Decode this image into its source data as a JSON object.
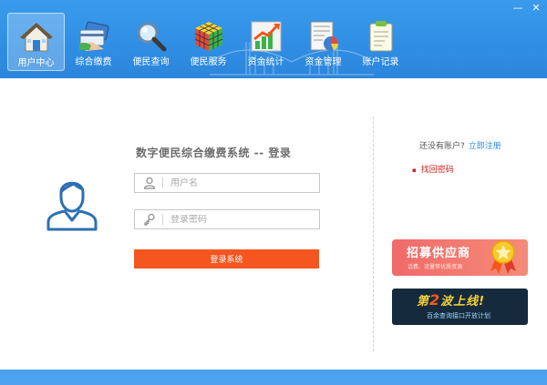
{
  "window": {
    "minimize": "—",
    "close": "✕"
  },
  "toolbar": {
    "items": [
      {
        "label": "用户中心",
        "icon": "home-icon",
        "active": true
      },
      {
        "label": "综合缴费",
        "icon": "payment-card-icon",
        "active": false
      },
      {
        "label": "便民查询",
        "icon": "magnifier-icon",
        "active": false
      },
      {
        "label": "便民服务",
        "icon": "cube-icon",
        "active": false
      },
      {
        "label": "资金统计",
        "icon": "bar-chart-icon",
        "active": false
      },
      {
        "label": "资金管理",
        "icon": "ledger-pie-icon",
        "active": false
      },
      {
        "label": "账户记录",
        "icon": "clipboard-icon",
        "active": false
      }
    ]
  },
  "login": {
    "title": "数字便民综合缴费系统 -- 登录",
    "username_placeholder": "用户名",
    "password_placeholder": "登录密码",
    "submit_label": "登录系统"
  },
  "side": {
    "no_account_text": "还没有账户?",
    "register_link": "立即注册",
    "find_password": "找回密码"
  },
  "banners": {
    "supplier_title": "招募供应商",
    "supplier_sub": "话费、流量等优质资源",
    "wave_prefix": "第",
    "wave_number": "2",
    "wave_suffix": "波上线!",
    "wave_sub": "百余查询接口开放计划"
  },
  "colors": {
    "header": "#2f8ee4",
    "login_button": "#f5551e",
    "link": "#2f8ee4",
    "alert_link": "#d21e1e"
  }
}
